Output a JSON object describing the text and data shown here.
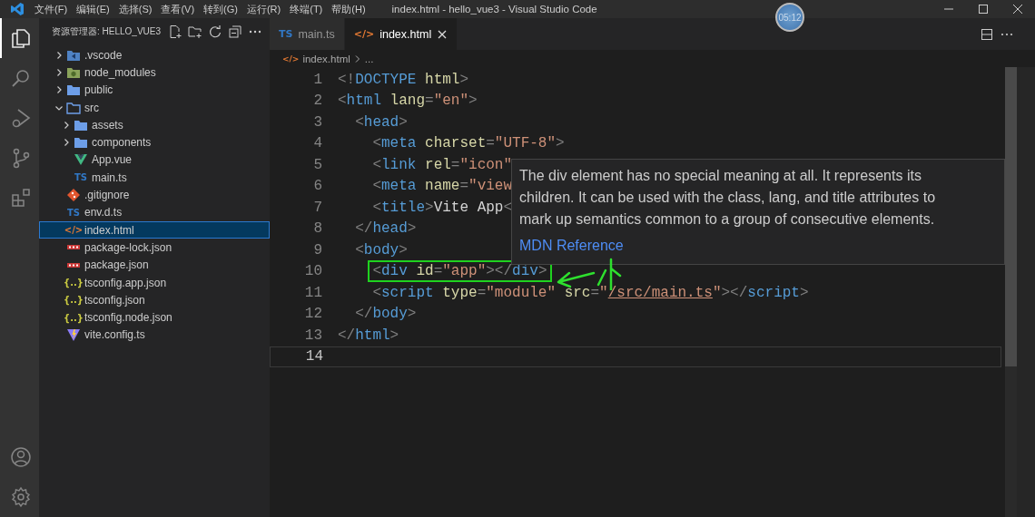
{
  "window": {
    "title": "index.html - hello_vue3 - Visual Studio Code",
    "timer": "05:12",
    "menu": [
      "文件(F)",
      "编辑(E)",
      "选择(S)",
      "查看(V)",
      "转到(G)",
      "运行(R)",
      "终端(T)",
      "帮助(H)"
    ]
  },
  "activity_bar": {
    "top": [
      {
        "kind": "files",
        "selected": true
      },
      {
        "kind": "search",
        "selected": false
      },
      {
        "kind": "debug",
        "selected": false
      },
      {
        "kind": "source-control",
        "selected": false
      },
      {
        "kind": "extensions",
        "selected": false
      }
    ],
    "bottom": [
      {
        "kind": "account"
      },
      {
        "kind": "settings"
      }
    ]
  },
  "sidebar": {
    "title": "资源管理器: HELLO_VUE3",
    "tree": [
      {
        "name": ".vscode",
        "kind": "vscode-folder",
        "expanded": false,
        "selected": false
      },
      {
        "name": "node_modules",
        "kind": "node-folder",
        "expanded": false,
        "selected": false
      },
      {
        "name": "public",
        "kind": "folder",
        "expanded": false,
        "selected": false
      },
      {
        "name": "src",
        "kind": "folder",
        "expanded": true,
        "selected": false,
        "children": [
          {
            "name": "assets",
            "kind": "folder",
            "expanded": false,
            "selected": false
          },
          {
            "name": "components",
            "kind": "folder",
            "expanded": false,
            "selected": false
          },
          {
            "name": "App.vue",
            "kind": "vue",
            "selected": false
          },
          {
            "name": "main.ts",
            "kind": "ts",
            "badge": "TS",
            "selected": false
          }
        ]
      },
      {
        "name": ".gitignore",
        "kind": "git",
        "selected": false
      },
      {
        "name": "env.d.ts",
        "kind": "ts",
        "badge": "TS",
        "selected": false
      },
      {
        "name": "index.html",
        "kind": "html",
        "badge": "</>",
        "selected": true
      },
      {
        "name": "package-lock.json",
        "kind": "npm",
        "selected": false
      },
      {
        "name": "package.json",
        "kind": "npm",
        "selected": false
      },
      {
        "name": "tsconfig.app.json",
        "kind": "json",
        "badge": "{..}",
        "selected": false
      },
      {
        "name": "tsconfig.json",
        "kind": "json",
        "badge": "{..}",
        "selected": false
      },
      {
        "name": "tsconfig.node.json",
        "kind": "json",
        "badge": "{..}",
        "selected": false
      },
      {
        "name": "vite.config.ts",
        "kind": "vite",
        "selected": false
      }
    ]
  },
  "tabs": [
    {
      "label": "main.ts",
      "kind": "ts",
      "badge": "TS",
      "selected": false
    },
    {
      "label": "index.html",
      "kind": "html",
      "badge": "</>",
      "selected": true
    }
  ],
  "breadcrumb": {
    "kind": "html",
    "badge": "</>",
    "items": [
      "index.html",
      "..."
    ]
  },
  "editor": {
    "lines": [
      {
        "number": "1",
        "boxed": false,
        "current": false,
        "tokens": [
          {
            "kind": "p",
            "t": "<!"
          },
          {
            "kind": "tag",
            "t": "DOCTYPE"
          },
          {
            "kind": "attr",
            "t": " html"
          },
          {
            "kind": "p",
            "t": ">"
          }
        ]
      },
      {
        "number": "2",
        "boxed": false,
        "current": false,
        "tokens": [
          {
            "kind": "p",
            "t": "<"
          },
          {
            "kind": "tag",
            "t": "html"
          },
          {
            "kind": "attr",
            "t": " lang"
          },
          {
            "kind": "p",
            "t": "="
          },
          {
            "kind": "str",
            "t": "\"en\""
          },
          {
            "kind": "p",
            "t": ">"
          }
        ]
      },
      {
        "number": "3",
        "boxed": false,
        "current": false,
        "tokens": [
          {
            "kind": "p",
            "t": "  <"
          },
          {
            "kind": "tag",
            "t": "head"
          },
          {
            "kind": "p",
            "t": ">"
          }
        ]
      },
      {
        "number": "4",
        "boxed": false,
        "current": false,
        "tokens": [
          {
            "kind": "p",
            "t": "    <"
          },
          {
            "kind": "tag",
            "t": "meta"
          },
          {
            "kind": "attr",
            "t": " charset"
          },
          {
            "kind": "p",
            "t": "="
          },
          {
            "kind": "str",
            "t": "\"UTF-8\""
          },
          {
            "kind": "p",
            "t": ">"
          }
        ]
      },
      {
        "number": "5",
        "boxed": false,
        "current": false,
        "tokens": [
          {
            "kind": "p",
            "t": "    <"
          },
          {
            "kind": "tag",
            "t": "link"
          },
          {
            "kind": "attr",
            "t": " rel"
          },
          {
            "kind": "p",
            "t": "="
          },
          {
            "kind": "str",
            "t": "\"icon\""
          }
        ]
      },
      {
        "number": "6",
        "boxed": false,
        "current": false,
        "tokens": [
          {
            "kind": "p",
            "t": "    <"
          },
          {
            "kind": "tag",
            "t": "meta"
          },
          {
            "kind": "attr",
            "t": " name"
          },
          {
            "kind": "p",
            "t": "="
          },
          {
            "kind": "str",
            "t": "\"view"
          }
        ]
      },
      {
        "number": "7",
        "boxed": false,
        "current": false,
        "tokens": [
          {
            "kind": "p",
            "t": "    <"
          },
          {
            "kind": "tag",
            "t": "title"
          },
          {
            "kind": "p",
            "t": ">"
          },
          {
            "kind": "txt",
            "t": "Vite App"
          },
          {
            "kind": "p",
            "t": "<"
          }
        ]
      },
      {
        "number": "8",
        "boxed": false,
        "current": false,
        "tokens": [
          {
            "kind": "p",
            "t": "  </"
          },
          {
            "kind": "tag",
            "t": "head"
          },
          {
            "kind": "p",
            "t": ">"
          }
        ]
      },
      {
        "number": "9",
        "boxed": false,
        "current": false,
        "tokens": [
          {
            "kind": "p",
            "t": "  <"
          },
          {
            "kind": "tag",
            "t": "body"
          },
          {
            "kind": "p",
            "t": ">"
          }
        ]
      },
      {
        "number": "10",
        "boxed": true,
        "current": false,
        "tokens": [
          {
            "kind": "p",
            "t": "    <"
          },
          {
            "kind": "tag",
            "t": "div"
          },
          {
            "kind": "attr",
            "t": " id"
          },
          {
            "kind": "p",
            "t": "="
          },
          {
            "kind": "str",
            "t": "\"app\""
          },
          {
            "kind": "p",
            "t": "></"
          },
          {
            "kind": "tag",
            "t": "div"
          },
          {
            "kind": "p",
            "t": ">"
          }
        ]
      },
      {
        "number": "11",
        "boxed": false,
        "current": false,
        "tokens": [
          {
            "kind": "p",
            "t": "    <"
          },
          {
            "kind": "tag",
            "t": "script"
          },
          {
            "kind": "attr",
            "t": " type"
          },
          {
            "kind": "p",
            "t": "="
          },
          {
            "kind": "str",
            "t": "\"module\""
          },
          {
            "kind": "attr",
            "t": " src"
          },
          {
            "kind": "p",
            "t": "="
          },
          {
            "kind": "str",
            "t": "\""
          },
          {
            "kind": "link",
            "t": "/src/main.ts"
          },
          {
            "kind": "str",
            "t": "\""
          },
          {
            "kind": "p",
            "t": "></"
          },
          {
            "kind": "tag",
            "t": "script"
          },
          {
            "kind": "p",
            "t": ">"
          }
        ]
      },
      {
        "number": "12",
        "boxed": false,
        "current": false,
        "tokens": [
          {
            "kind": "p",
            "t": "  </"
          },
          {
            "kind": "tag",
            "t": "body"
          },
          {
            "kind": "p",
            "t": ">"
          }
        ]
      },
      {
        "number": "13",
        "boxed": false,
        "current": false,
        "tokens": [
          {
            "kind": "p",
            "t": "</"
          },
          {
            "kind": "tag",
            "t": "html"
          },
          {
            "kind": "p",
            "t": ">"
          }
        ]
      },
      {
        "number": "14",
        "boxed": false,
        "current": true
      }
    ]
  },
  "tooltip": {
    "text": "The div element has no special meaning at all. It represents its children. It can be used with the class, lang, and title attributes to mark up semantics common to a group of consecutive elements.",
    "link": "MDN Reference"
  }
}
